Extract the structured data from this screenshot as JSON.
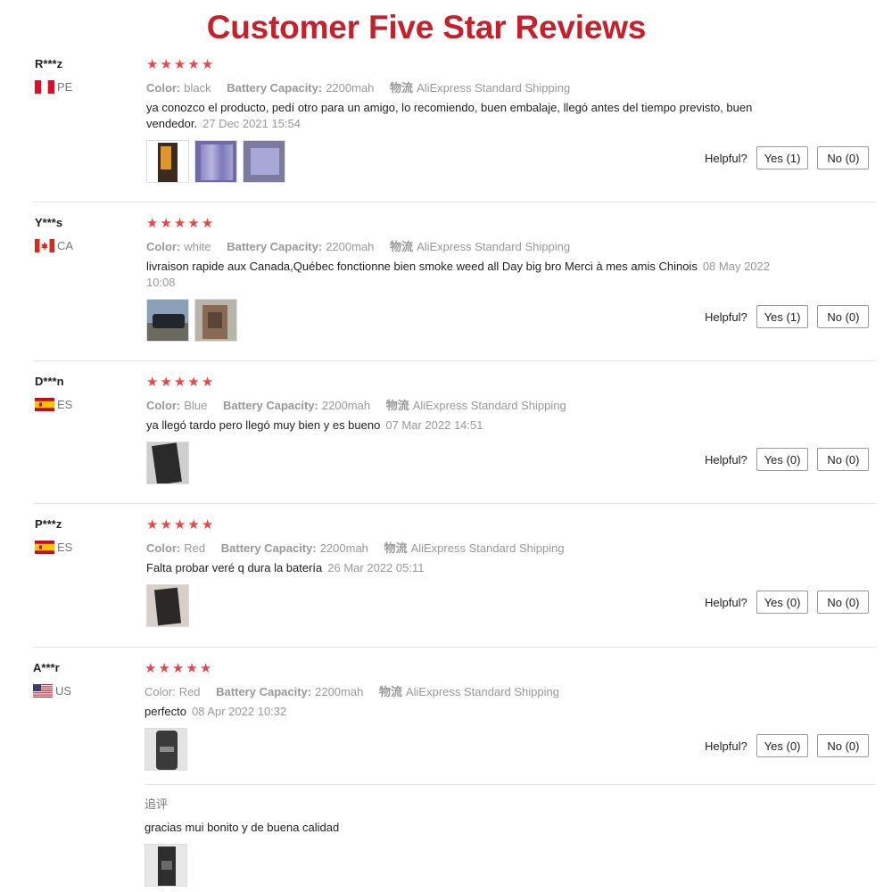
{
  "page_title": "Customer Five Star Reviews",
  "helpful_label": "Helpful?",
  "labels": {
    "color": "Color:",
    "capacity": "Battery Capacity:",
    "shipping": "物流"
  },
  "reviews": [
    {
      "user": "R***z",
      "country": "PE",
      "rating": 5,
      "color": "black",
      "capacity": "2200mah",
      "shipping": "AliExpress Standard Shipping",
      "text": "ya conozco el producto, pedí otro para un amigo, lo recomiendo, buen embalaje, llegó antes del tiempo previsto, buen vendedor.",
      "date": "27 Dec 2021 15:54",
      "yes": "Yes (1)",
      "no": "No (0)"
    },
    {
      "user": "Y***s",
      "country": "CA",
      "rating": 5,
      "color": "white",
      "capacity": "2200mah",
      "shipping": "AliExpress Standard Shipping",
      "text": "livraison rapide aux Canada,Québec fonctionne bien smoke weed all Day big bro Merci à mes amis Chinois",
      "date": "08 May 2022 10:08",
      "yes": "Yes (1)",
      "no": "No (0)"
    },
    {
      "user": "D***n",
      "country": "ES",
      "rating": 5,
      "color": "Blue",
      "capacity": "2200mah",
      "shipping": "AliExpress Standard Shipping",
      "text": "ya llegó tardo pero llegó muy bien y es bueno",
      "date": "07 Mar 2022 14:51",
      "yes": "Yes (0)",
      "no": "No (0)"
    },
    {
      "user": "P***z",
      "country": "ES",
      "rating": 5,
      "color": "Red",
      "capacity": "2200mah",
      "shipping": "AliExpress Standard Shipping",
      "text": "Falta probar veré q dura la batería",
      "date": "26 Mar 2022 05:11",
      "yes": "Yes (0)",
      "no": "No (0)"
    },
    {
      "user": "A***r",
      "country": "US",
      "rating": 5,
      "color": "Red",
      "capacity": "2200mah",
      "shipping": "AliExpress Standard Shipping",
      "text": "perfecto",
      "date": "08 Apr 2022 10:32",
      "yes": "Yes (0)",
      "no": "No (0)",
      "followup_label": "追评",
      "followup_text": "gracias mui bonito y de buena calidad"
    }
  ],
  "colors": {
    "title": "#c8202b",
    "star": "#e6464d",
    "muted": "#999999"
  }
}
